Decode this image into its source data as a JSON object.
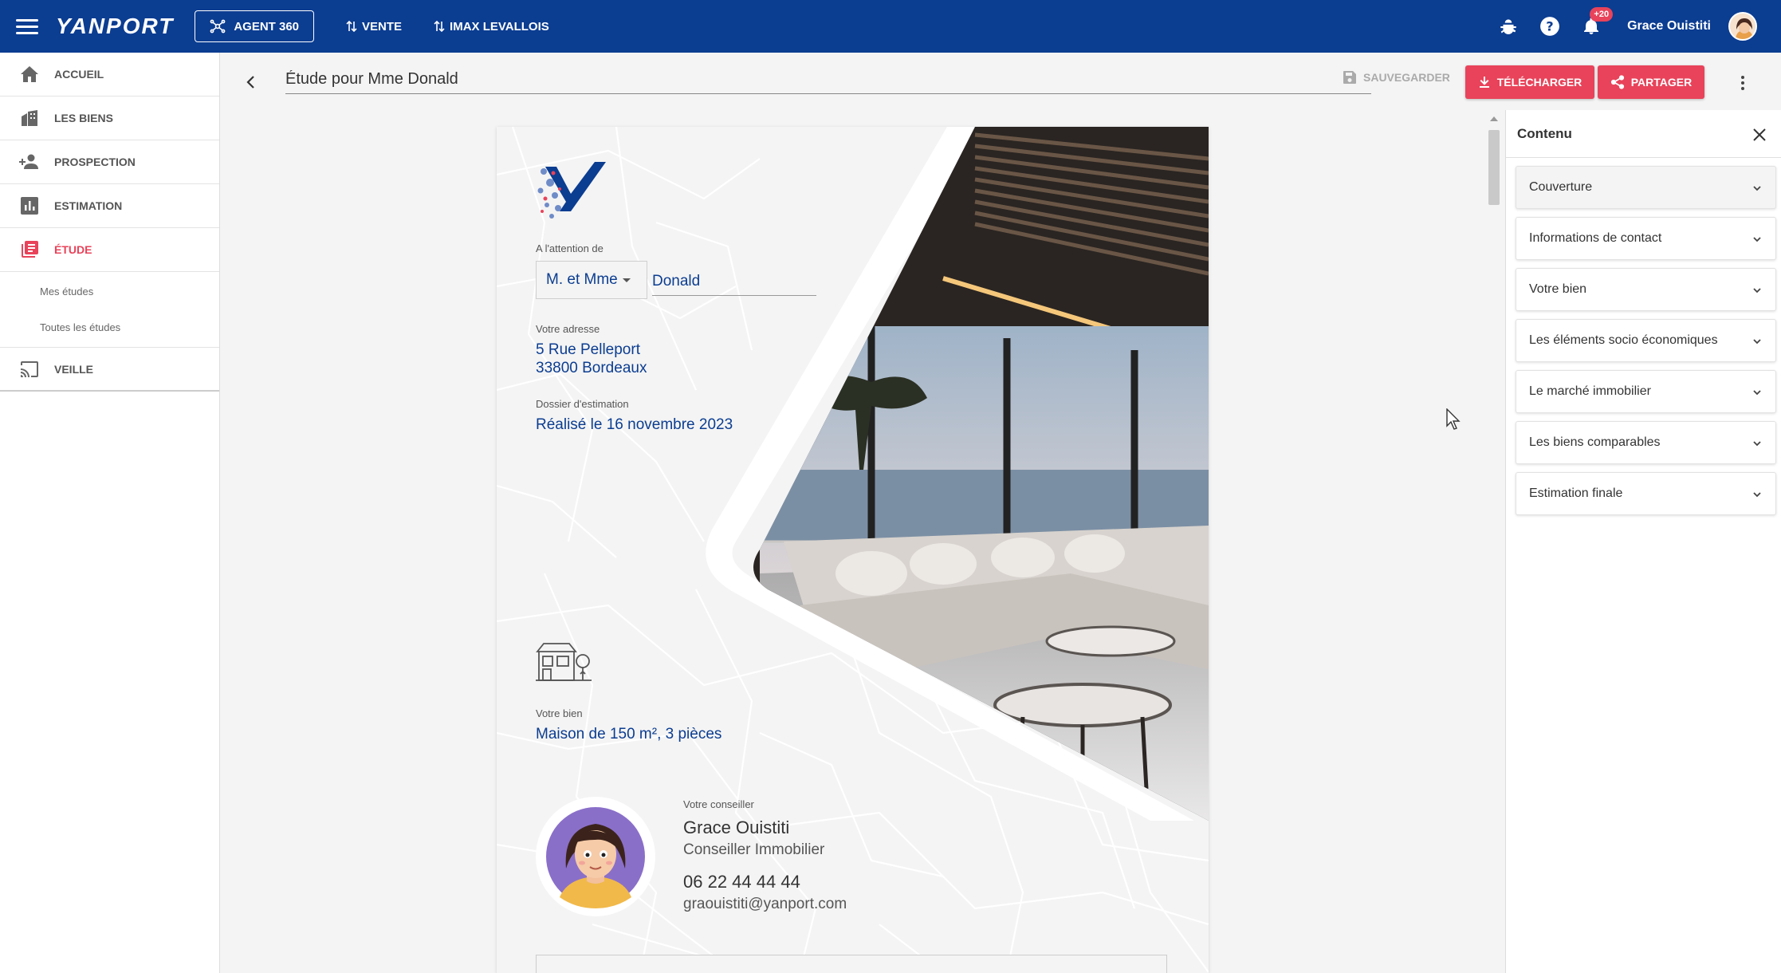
{
  "app": {
    "logo": "YANPORT"
  },
  "topbar": {
    "agent_label": "AGENT 360",
    "nav": [
      "VENTE",
      "IMAX LEVALLOIS"
    ],
    "notification_count": "+20",
    "user_name": "Grace Ouistiti"
  },
  "sidebar": {
    "items": [
      {
        "label": "ACCUEIL",
        "icon": "home-icon"
      },
      {
        "label": "LES BIENS",
        "icon": "buildings-icon"
      },
      {
        "label": "PROSPECTION",
        "icon": "person-add-icon"
      },
      {
        "label": "ESTIMATION",
        "icon": "bar-chart-icon"
      },
      {
        "label": "ÉTUDE",
        "icon": "library-icon",
        "active": true
      },
      {
        "label": "VEILLE",
        "icon": "cast-icon"
      }
    ],
    "sub_items": [
      "Mes études",
      "Toutes les études"
    ]
  },
  "header": {
    "title_value": "Étude pour Mme Donald",
    "save_label": "SAUVEGARDER",
    "download_label": "TÉLÉCHARGER",
    "share_label": "PARTAGER"
  },
  "document": {
    "attention_label": "A l'attention de",
    "civility": "M. et Mme",
    "last_name": "Donald",
    "address_label": "Votre adresse",
    "address_line1": "5 Rue Pelleport",
    "address_line2": "33800 Bordeaux",
    "dossier_label": "Dossier d'estimation",
    "dossier_value": "Réalisé le 16 novembre 2023",
    "bien_label": "Votre bien",
    "bien_value": "Maison de 150 m², 3 pièces",
    "advisor_label": "Votre conseiller",
    "advisor_name": "Grace Ouistiti",
    "advisor_role": "Conseiller Immobilier",
    "advisor_phone": "06 22 44 44 44",
    "advisor_email": "graouistiti@yanport.com"
  },
  "panel": {
    "title": "Contenu",
    "sections": [
      "Couverture",
      "Informations de contact",
      "Votre bien",
      "Les éléments socio économiques",
      "Le marché immobilier",
      "Les biens comparables",
      "Estimation finale"
    ]
  },
  "colors": {
    "primary": "#0b3d91",
    "accent": "#e8435a"
  }
}
